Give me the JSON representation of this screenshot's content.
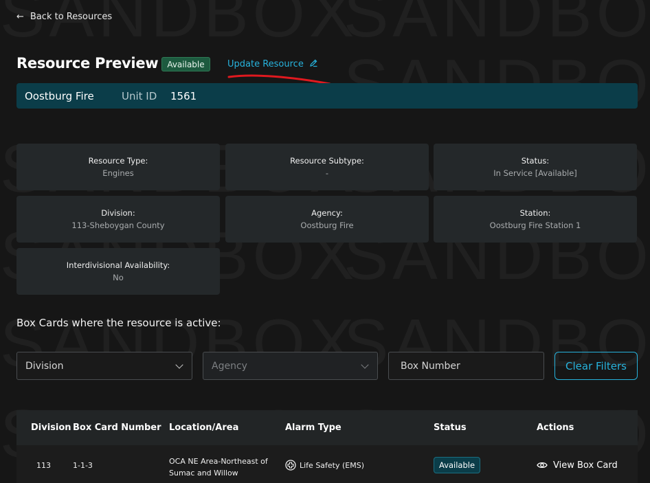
{
  "watermark": "SANDBOX",
  "nav": {
    "back_label": "Back to Resources"
  },
  "header": {
    "title": "Resource Preview",
    "status_badge": "Available",
    "update_link": "Update Resource"
  },
  "unit": {
    "name": "Oostburg Fire",
    "id_label": "Unit ID",
    "id_value": "1561"
  },
  "details": [
    {
      "label": "Resource Type:",
      "value": "Engines"
    },
    {
      "label": "Resource Subtype:",
      "value": "-"
    },
    {
      "label": "Status:",
      "value": "In Service [Available]"
    },
    {
      "label": "Division:",
      "value": "113-Sheboygan County"
    },
    {
      "label": "Agency:",
      "value": "Oostburg Fire"
    },
    {
      "label": "Station:",
      "value": "Oostburg Fire Station 1"
    },
    {
      "label": "Interdivisional Availability:",
      "value": "No"
    }
  ],
  "box_cards": {
    "heading": "Box Cards where the resource is active:",
    "filters": {
      "division_placeholder": "Division",
      "agency_placeholder": "Agency",
      "box_number_placeholder": "Box Number",
      "clear_label": "Clear Filters"
    },
    "columns": [
      "Division",
      "Box Card Number",
      "Location/Area",
      "Alarm Type",
      "Status",
      "Actions"
    ],
    "rows": [
      {
        "division": "113",
        "box_card_number": "1-1-3",
        "location_line1": "OCA NE Area-Northeast of",
        "location_line2": "Sumac and Willow",
        "alarm_type": "Life Safety (EMS)",
        "status": "Available",
        "action": "View Box Card"
      }
    ]
  },
  "colors": {
    "accent": "#27b3dd",
    "unit_bar": "#0b3d49",
    "available_badge": "#1d5a3f",
    "annotation": "#e0191f"
  }
}
